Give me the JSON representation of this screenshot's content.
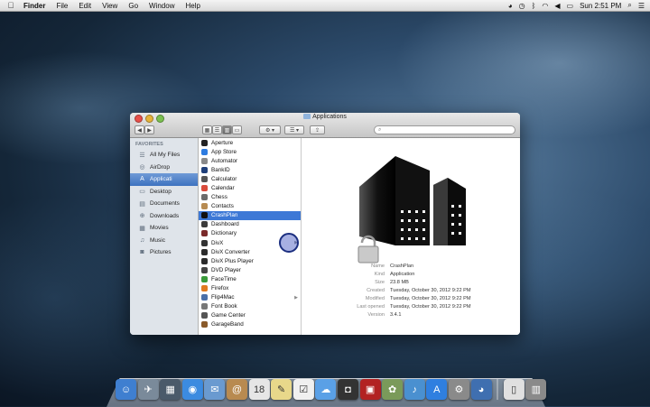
{
  "menubar": {
    "apple_icon": "apple-icon",
    "items": [
      "Finder",
      "File",
      "Edit",
      "View",
      "Go",
      "Window",
      "Help"
    ],
    "clock": "Sun 2:51 PM"
  },
  "window": {
    "title": "Applications",
    "search_placeholder": ""
  },
  "sidebar": {
    "heading": "FAVORITES",
    "items": [
      {
        "label": "All My Files",
        "icon": "all-files-icon",
        "glyph": "☰"
      },
      {
        "label": "AirDrop",
        "icon": "airdrop-icon",
        "glyph": "◎"
      },
      {
        "label": "Applicati",
        "icon": "applications-icon",
        "glyph": "A",
        "active": true
      },
      {
        "label": "Desktop",
        "icon": "desktop-icon",
        "glyph": "▭"
      },
      {
        "label": "Documents",
        "icon": "documents-icon",
        "glyph": "▤"
      },
      {
        "label": "Downloads",
        "icon": "downloads-icon",
        "glyph": "⊕"
      },
      {
        "label": "Movies",
        "icon": "movies-icon",
        "glyph": "▦"
      },
      {
        "label": "Music",
        "icon": "music-icon",
        "glyph": "♫"
      },
      {
        "label": "Pictures",
        "icon": "pictures-icon",
        "glyph": "◙"
      }
    ]
  },
  "apps": [
    {
      "label": "Aperture",
      "color": "#222222"
    },
    {
      "label": "App Store",
      "color": "#2d7be0"
    },
    {
      "label": "Automator",
      "color": "#8a8a8a"
    },
    {
      "label": "BankID",
      "color": "#1f3f7a"
    },
    {
      "label": "Calculator",
      "color": "#555555"
    },
    {
      "label": "Calendar",
      "color": "#d94b3b"
    },
    {
      "label": "Chess",
      "color": "#6b6b6b"
    },
    {
      "label": "Contacts",
      "color": "#b78b52"
    },
    {
      "label": "CrashPlan",
      "color": "#111111",
      "selected": true
    },
    {
      "label": "Dashboard",
      "color": "#3b3b3b"
    },
    {
      "label": "Dictionary",
      "color": "#7a2a2a"
    },
    {
      "label": "DivX",
      "color": "#333333",
      "folder": true
    },
    {
      "label": "DivX Converter",
      "color": "#2b2b2b"
    },
    {
      "label": "DivX Plus Player",
      "color": "#2b2b2b"
    },
    {
      "label": "DVD Player",
      "color": "#444444"
    },
    {
      "label": "FaceTime",
      "color": "#3a9a3a"
    },
    {
      "label": "Firefox",
      "color": "#e07a20"
    },
    {
      "label": "Flip4Mac",
      "color": "#4a6fa8",
      "folder": true
    },
    {
      "label": "Font Book",
      "color": "#777777"
    },
    {
      "label": "Game Center",
      "color": "#555555"
    },
    {
      "label": "GarageBand",
      "color": "#8a5a2a"
    }
  ],
  "preview": {
    "rows": [
      {
        "key": "Name",
        "value": "CrashPlan"
      },
      {
        "key": "Kind",
        "value": "Application"
      },
      {
        "key": "Size",
        "value": "23.8 MB"
      },
      {
        "key": "Created",
        "value": "Tuesday, October 30, 2012 9:22 PM"
      },
      {
        "key": "Modified",
        "value": "Tuesday, October 30, 2012 9:22 PM"
      },
      {
        "key": "Last opened",
        "value": "Tuesday, October 30, 2012 9:22 PM"
      },
      {
        "key": "Version",
        "value": "3.4.1"
      }
    ]
  },
  "dock": [
    {
      "name": "finder",
      "color": "#3f7fd0",
      "glyph": "☺"
    },
    {
      "name": "launchpad",
      "color": "#7a8a9a",
      "glyph": "✈"
    },
    {
      "name": "mission-control",
      "color": "#4a5a6a",
      "glyph": "▦"
    },
    {
      "name": "safari",
      "color": "#3c8be0",
      "glyph": "◉"
    },
    {
      "name": "mail",
      "color": "#6a9ad0",
      "glyph": "✉"
    },
    {
      "name": "contacts",
      "color": "#b88a50",
      "glyph": "@"
    },
    {
      "name": "calendar",
      "color": "#e6e6e6",
      "glyph": "18"
    },
    {
      "name": "notes",
      "color": "#e8d88a",
      "glyph": "✎"
    },
    {
      "name": "reminders",
      "color": "#f0f0f0",
      "glyph": "☑"
    },
    {
      "name": "messages",
      "color": "#5aa0e6",
      "glyph": "☁"
    },
    {
      "name": "facetime",
      "color": "#333333",
      "glyph": "◘"
    },
    {
      "name": "photo-booth",
      "color": "#b22222",
      "glyph": "▣"
    },
    {
      "name": "iphoto",
      "color": "#7a9a5a",
      "glyph": "✿"
    },
    {
      "name": "itunes",
      "color": "#4a90d0",
      "glyph": "♪"
    },
    {
      "name": "app-store",
      "color": "#2f7fe0",
      "glyph": "A"
    },
    {
      "name": "system-preferences",
      "color": "#8a8a8a",
      "glyph": "⚙"
    },
    {
      "name": "crashplan",
      "color": "#3f6fb0",
      "glyph": "◕"
    },
    {
      "name": "documents-stack",
      "color": "#e0e0e0",
      "glyph": "▯"
    },
    {
      "name": "trash",
      "color": "#8a8a8a",
      "glyph": "▥"
    }
  ]
}
